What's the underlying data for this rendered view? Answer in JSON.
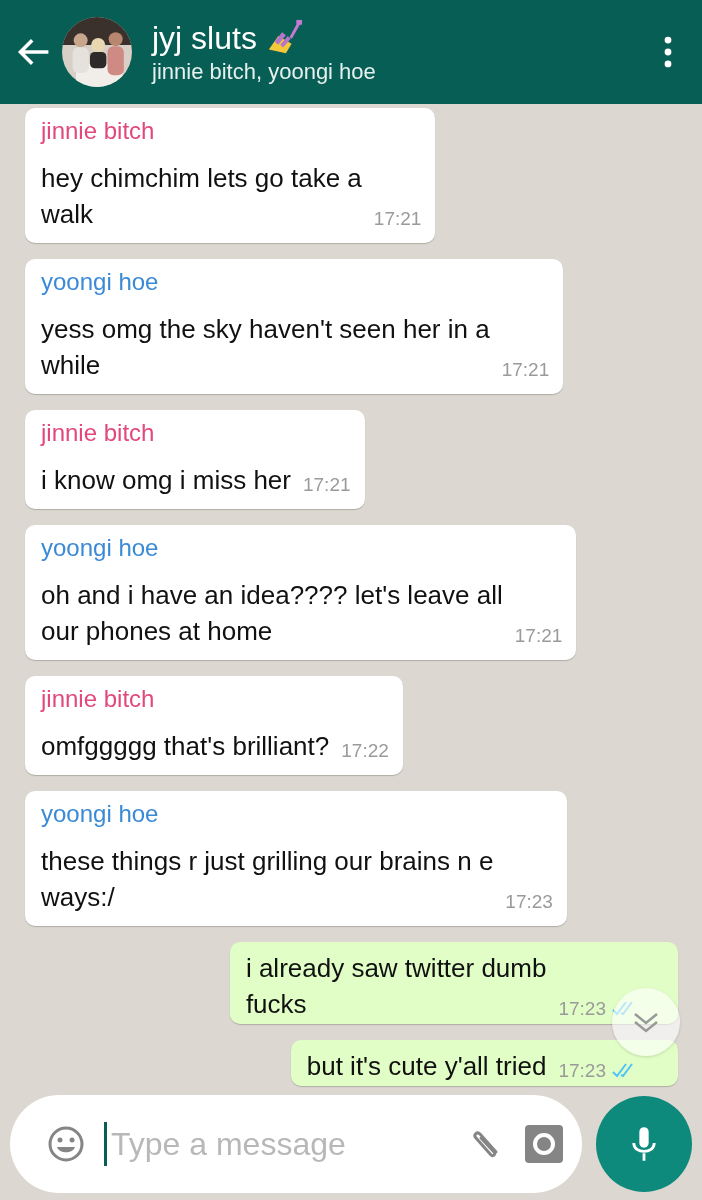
{
  "header": {
    "title": "jyj sluts",
    "subtitle": "jinnie bitch, yoongi hoe"
  },
  "messages": [
    {
      "kind": "incoming",
      "sender": "jinnie bitch",
      "color": "#e2487c",
      "text": "hey chimchim lets go take a\nwalk",
      "time": "17:21"
    },
    {
      "kind": "incoming",
      "sender": "yoongi hoe",
      "color": "#3a8ad6",
      "text": "yess omg the sky haven't seen her in a\nwhile",
      "time": "17:21"
    },
    {
      "kind": "incoming",
      "sender": "jinnie bitch",
      "color": "#e2487c",
      "text": "i know omg i miss her",
      "time": "17:21"
    },
    {
      "kind": "incoming",
      "sender": "yoongi hoe",
      "color": "#3a8ad6",
      "text": "oh and i have an idea???? let's leave all\nour phones at home",
      "time": "17:21"
    },
    {
      "kind": "incoming",
      "sender": "jinnie bitch",
      "color": "#e2487c",
      "text": "omfggggg that's brilliant?",
      "time": "17:22"
    },
    {
      "kind": "incoming",
      "sender": "yoongi hoe",
      "color": "#3a8ad6",
      "text": "these things r just grilling our brains n e\nways:/",
      "time": "17:23"
    },
    {
      "kind": "outgoing",
      "text": "i already saw twitter dumb\nfucks",
      "time": "17:23",
      "read": true
    },
    {
      "kind": "outgoing",
      "text": "but it's cute y'all tried",
      "time": "17:23",
      "read": true
    }
  ],
  "composer": {
    "placeholder": "Type a message"
  }
}
